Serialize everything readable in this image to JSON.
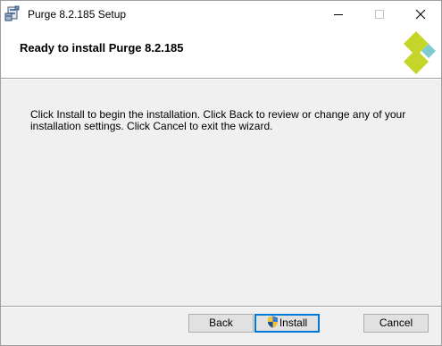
{
  "window": {
    "title": "Purge 8.2.185 Setup",
    "app_icon": "installer-package-icon",
    "caption_buttons": [
      "minimize-icon",
      "maximize-icon",
      "close-icon"
    ]
  },
  "banner": {
    "title": "Ready to install Purge 8.2.185",
    "logo": "diamond-logo-icon",
    "logo_colors": [
      "#c5d52a",
      "#7ecbd0"
    ]
  },
  "body": {
    "message": "Click Install to begin the installation. Click Back to review or change any of your installation settings. Click Cancel to exit the wizard."
  },
  "footer": {
    "back_label": "Back",
    "install_label": "Install",
    "install_icon": "uac-shield-icon",
    "cancel_label": "Cancel"
  },
  "colors": {
    "accent": "#0078d7",
    "dialog_background": "#f0f0f0"
  }
}
